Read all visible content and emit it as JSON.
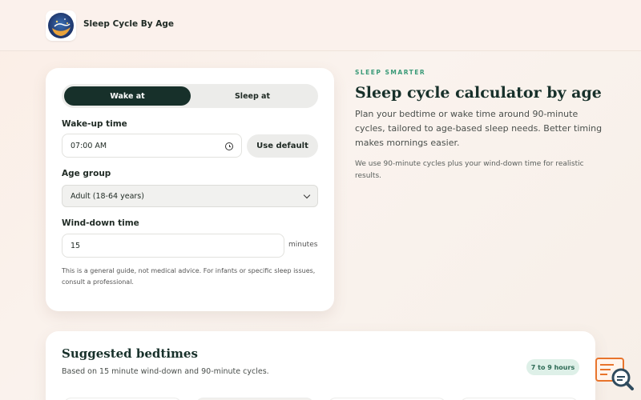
{
  "header": {
    "brand": "Sleep Cycle By Age",
    "logo_icon": "moon-logo-icon"
  },
  "form": {
    "toggle": {
      "wake_label": "Wake at",
      "sleep_label": "Sleep at",
      "active": "Wake at"
    },
    "wake_label": "Wake-up time",
    "wake_value": "07:00 AM",
    "use_default_label": "Use default",
    "age_label": "Age group",
    "age_value": "Adult (18-64 years)",
    "winddown_label": "Wind-down time",
    "winddown_value": "15",
    "winddown_units": "minutes",
    "note": "This is a general guide, not medical advice. For infants or specific sleep issues, consult a professional."
  },
  "hero": {
    "kicker": "SLEEP SMARTER",
    "title": "Sleep cycle calculator by age",
    "description": "Plan your bedtime or wake time around 90-minute cycles, tailored to age-based sleep needs. Better timing makes mornings easier.",
    "subtext": "We use 90-minute cycles plus your wind-down time for realistic results."
  },
  "results": {
    "title": "Suggested bedtimes",
    "subtitle": "Based on 15 minute wind-down and 90-minute cycles.",
    "badge": "7 to 9 hours"
  },
  "colors": {
    "accent_dark": "#17302a",
    "accent_green": "#3a9a78",
    "widget_orange": "#e8742c"
  }
}
